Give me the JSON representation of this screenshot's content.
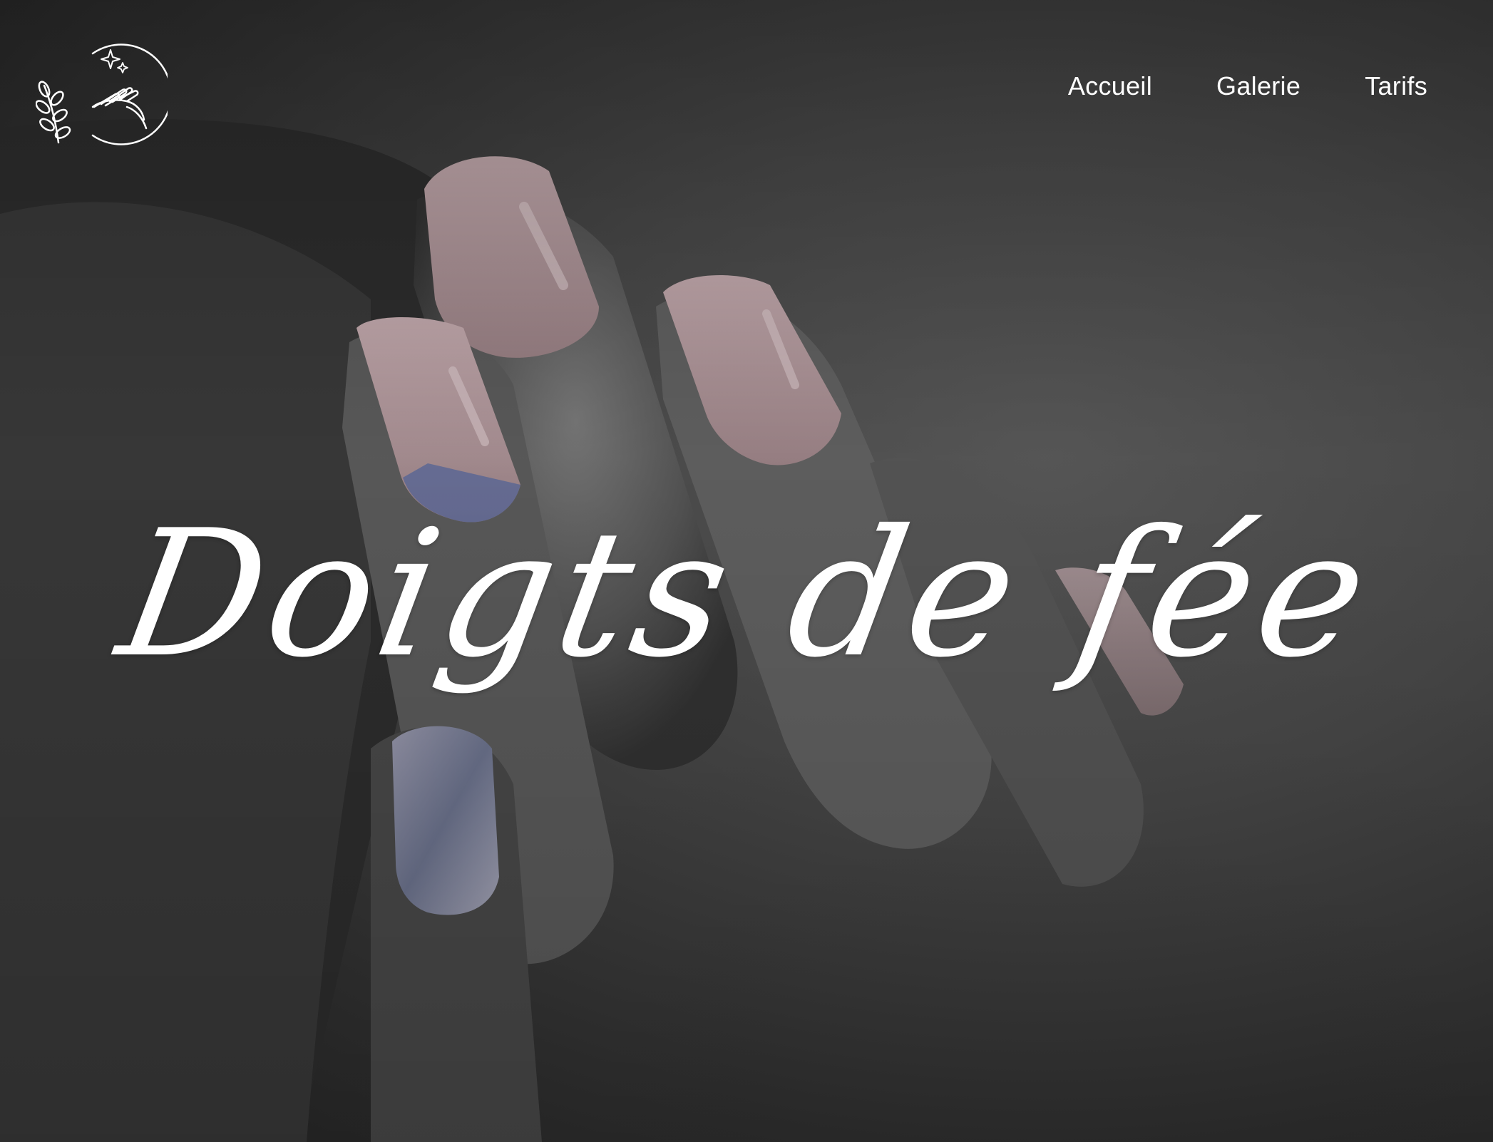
{
  "brand": {
    "logo_icon": "hand-with-leaves-and-sparkles-icon"
  },
  "nav": {
    "items": [
      {
        "label": "Accueil"
      },
      {
        "label": "Galerie"
      },
      {
        "label": "Tarifs"
      }
    ]
  },
  "hero": {
    "title": "Doigts de fée",
    "image": "close-up-hand-with-manicured-nails-photo"
  },
  "colors": {
    "text": "#ffffff",
    "nail_pink": "#b89a9e",
    "skin_gray": "#6e6e6e"
  }
}
